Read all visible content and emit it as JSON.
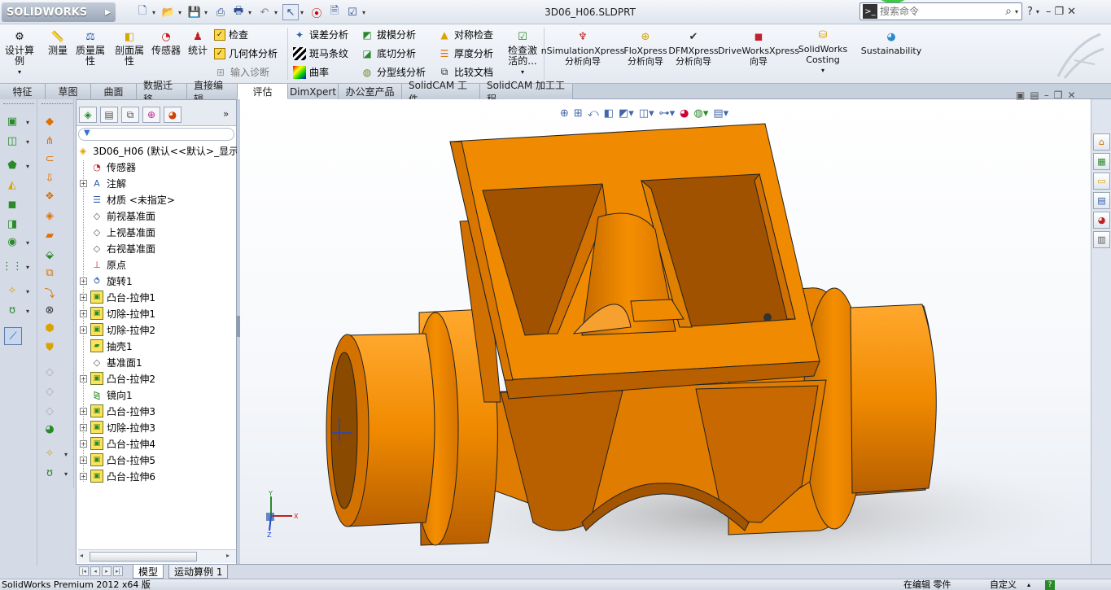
{
  "app": {
    "logo": "SOLIDWORKS",
    "document_title": "3D06_H06.SLDPRT"
  },
  "search": {
    "placeholder": "搜索命令"
  },
  "ribbon": {
    "big_buttons": [
      {
        "key": "design-study",
        "label": "设计算例"
      },
      {
        "key": "measure",
        "label": "测量"
      },
      {
        "key": "mass-props",
        "label": "质量属性"
      },
      {
        "key": "section-props",
        "label": "剖面属性"
      },
      {
        "key": "sensor",
        "label": "传感器"
      },
      {
        "key": "statistics",
        "label": "统计"
      }
    ],
    "col1": {
      "check": "检查",
      "geometry": "几何体分析",
      "import_diag": "输入诊断"
    },
    "col2": {
      "deviation": "误差分析",
      "zebra": "斑马条纹",
      "curvature": "曲率"
    },
    "col3": {
      "draft": "拔模分析",
      "undercut": "底切分析",
      "parting": "分型线分析"
    },
    "col4": {
      "symmetry": "对称检查",
      "thickness": "厚度分析",
      "compare": "比较文档"
    },
    "check_active": "检查激活的...",
    "xpress": [
      {
        "key": "simxpress",
        "label": "nSimulationXpress 分析向导"
      },
      {
        "key": "floxpress",
        "label": "FloXpress 分析向导"
      },
      {
        "key": "dfmxpress",
        "label": "DFMXpress 分析向导"
      },
      {
        "key": "driveworks",
        "label": "DriveWorksXpress 向导"
      },
      {
        "key": "costing",
        "label": "SolidWorks Costing"
      },
      {
        "key": "sustain",
        "label": "Sustainability"
      }
    ]
  },
  "tabs": [
    "特征",
    "草图",
    "曲面",
    "数据迁移",
    "直接编辑",
    "评估",
    "DimXpert",
    "办公室产品",
    "SolidCAM 工件",
    "SolidCAM 加工工程"
  ],
  "active_tab": "评估",
  "feature_tree": {
    "root": "3D06_H06  (默认<<默认>_显示",
    "items": [
      {
        "label": "传感器",
        "expand": false,
        "icon": "sensor"
      },
      {
        "label": "注解",
        "expand": true,
        "icon": "annotation"
      },
      {
        "label": "材质 <未指定>",
        "expand": false,
        "icon": "material"
      },
      {
        "label": "前视基准面",
        "expand": false,
        "icon": "plane"
      },
      {
        "label": "上视基准面",
        "expand": false,
        "icon": "plane"
      },
      {
        "label": "右视基准面",
        "expand": false,
        "icon": "plane"
      },
      {
        "label": "原点",
        "expand": false,
        "icon": "origin"
      },
      {
        "label": "旋转1",
        "expand": true,
        "icon": "revolve"
      },
      {
        "label": "凸台-拉伸1",
        "expand": true,
        "icon": "boss"
      },
      {
        "label": "切除-拉伸1",
        "expand": true,
        "icon": "cut"
      },
      {
        "label": "切除-拉伸2",
        "expand": true,
        "icon": "cut"
      },
      {
        "label": "抽壳1",
        "expand": false,
        "icon": "shell"
      },
      {
        "label": "基准面1",
        "expand": false,
        "icon": "plane"
      },
      {
        "label": "凸台-拉伸2",
        "expand": true,
        "icon": "boss"
      },
      {
        "label": "镜向1",
        "expand": false,
        "icon": "mirror"
      },
      {
        "label": "凸台-拉伸3",
        "expand": true,
        "icon": "boss"
      },
      {
        "label": "切除-拉伸3",
        "expand": true,
        "icon": "cut"
      },
      {
        "label": "凸台-拉伸4",
        "expand": true,
        "icon": "boss"
      },
      {
        "label": "凸台-拉伸5",
        "expand": true,
        "icon": "boss"
      },
      {
        "label": "凸台-拉伸6",
        "expand": true,
        "icon": "boss"
      }
    ]
  },
  "bottom_tabs": [
    "模型",
    "运动算例 1"
  ],
  "status": {
    "left": "SolidWorks Premium 2012 x64 版",
    "mode": "在编辑 零件",
    "custom": "自定义"
  },
  "triad": {
    "x": "X",
    "y": "Y",
    "z": "Z"
  },
  "colors": {
    "part": "#f08a00",
    "part_dark": "#b85f00",
    "part_light": "#ffa02a"
  }
}
